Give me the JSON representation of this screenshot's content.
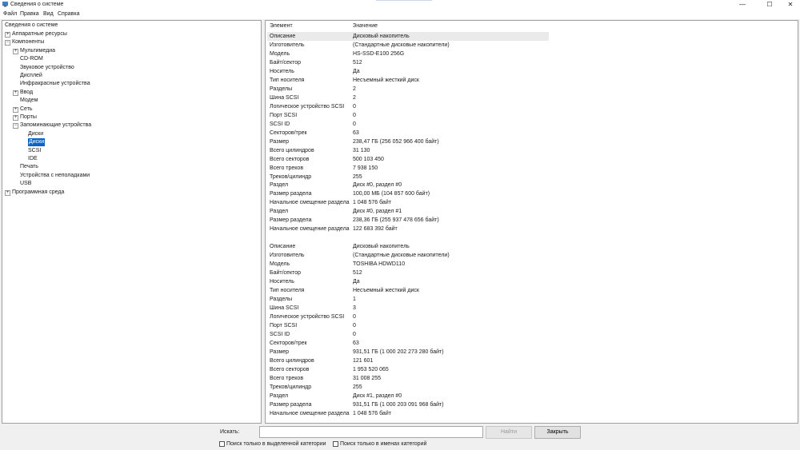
{
  "window": {
    "title": "Сведения о системе",
    "minimize": "—",
    "maximize": "☐",
    "close": "✕"
  },
  "menu": [
    "Файл",
    "Правка",
    "Вид",
    "Справка"
  ],
  "tree": {
    "root": "Сведения о системе",
    "items": [
      {
        "label": "Аппаратные ресурсы",
        "exp": "+"
      },
      {
        "label": "Компоненты",
        "exp": "−"
      },
      {
        "label": "Мультимедиа",
        "exp": "+"
      },
      {
        "label": "CD-ROM",
        "exp": ""
      },
      {
        "label": "Звуковое устройство",
        "exp": ""
      },
      {
        "label": "Дисплей",
        "exp": ""
      },
      {
        "label": "Инфракрасные устройства",
        "exp": ""
      },
      {
        "label": "Ввод",
        "exp": "+"
      },
      {
        "label": "Модем",
        "exp": ""
      },
      {
        "label": "Сеть",
        "exp": "+"
      },
      {
        "label": "Порты",
        "exp": "+"
      },
      {
        "label": "Запоминающие устройства",
        "exp": "−"
      },
      {
        "label": "Диски",
        "exp": ""
      },
      {
        "label": "Диски",
        "exp": "",
        "selected": true
      },
      {
        "label": "SCSI",
        "exp": ""
      },
      {
        "label": "IDE",
        "exp": ""
      },
      {
        "label": "Печать",
        "exp": ""
      },
      {
        "label": "Устройства с неполадками",
        "exp": ""
      },
      {
        "label": "USB",
        "exp": ""
      },
      {
        "label": "Программная среда",
        "exp": "+"
      }
    ]
  },
  "details": {
    "col_element": "Элемент",
    "col_value": "Значение",
    "rows": [
      [
        "Описание",
        "Дисковый накопитель"
      ],
      [
        "Изготовитель",
        "(Стандартные дисковые накопители)"
      ],
      [
        "Модель",
        "HS-SSD-E100 256G"
      ],
      [
        "Байт/сектор",
        "512"
      ],
      [
        "Носитель",
        "Да"
      ],
      [
        "Тип носителя",
        "Несъемный жесткий диск"
      ],
      [
        "Разделы",
        "2"
      ],
      [
        "Шина SCSI",
        "2"
      ],
      [
        "Логическое устройство SCSI",
        "0"
      ],
      [
        "Порт SCSI",
        "0"
      ],
      [
        "SCSI ID",
        "0"
      ],
      [
        "Секторов/трек",
        "63"
      ],
      [
        "Размер",
        "238,47 ГБ (256 052 966 400 байт)"
      ],
      [
        "Всего цилиндров",
        "31 130"
      ],
      [
        "Всего секторов",
        "500 103 450"
      ],
      [
        "Всего треков",
        "7 938 150"
      ],
      [
        "Треков/цилиндр",
        "255"
      ],
      [
        "Раздел",
        "Диск #0, раздел #0"
      ],
      [
        "Размер раздела",
        "100,00 МБ (104 857 600 байт)"
      ],
      [
        "Начальное смещение раздела",
        "1 048 576 байт"
      ],
      [
        "Раздел",
        "Диск #0, раздел #1"
      ],
      [
        "Размер раздела",
        "238,36 ГБ (255 937 478 656 байт)"
      ],
      [
        "Начальное смещение раздела",
        "122 683 392 байт"
      ],
      [
        "",
        ""
      ],
      [
        "Описание",
        "Дисковый накопитель"
      ],
      [
        "Изготовитель",
        "(Стандартные дисковые накопители)"
      ],
      [
        "Модель",
        "TOSHIBA HDWD110"
      ],
      [
        "Байт/сектор",
        "512"
      ],
      [
        "Носитель",
        "Да"
      ],
      [
        "Тип носителя",
        "Несъемный жесткий диск"
      ],
      [
        "Разделы",
        "1"
      ],
      [
        "Шина SCSI",
        "3"
      ],
      [
        "Логическое устройство SCSI",
        "0"
      ],
      [
        "Порт SCSI",
        "0"
      ],
      [
        "SCSI ID",
        "0"
      ],
      [
        "Секторов/трек",
        "63"
      ],
      [
        "Размер",
        "931,51 ГБ (1 000 202 273 280 байт)"
      ],
      [
        "Всего цилиндров",
        "121 601"
      ],
      [
        "Всего секторов",
        "1 953 520 065"
      ],
      [
        "Всего треков",
        "31 008 255"
      ],
      [
        "Треков/цилиндр",
        "255"
      ],
      [
        "Раздел",
        "Диск #1, раздел #0"
      ],
      [
        "Размер раздела",
        "931,51 ГБ (1 000 203 091 968 байт)"
      ],
      [
        "Начальное смещение раздела",
        "1 048 576 байт"
      ]
    ]
  },
  "search": {
    "label": "Искать:",
    "value": "",
    "find_button": "Найти",
    "close_button": "Закрыть",
    "check_selected": "Поиск только в выделенной категории",
    "check_names": "Поиск только в именах категорий"
  }
}
